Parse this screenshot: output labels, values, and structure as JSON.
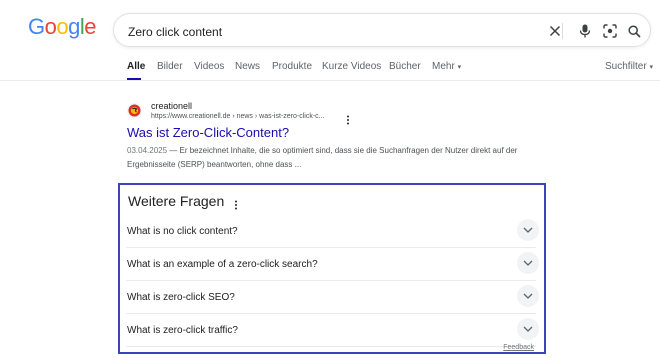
{
  "logo": {
    "letters": [
      "G",
      "o",
      "o",
      "g",
      "l",
      "e"
    ],
    "colors": [
      "#4285f4",
      "#ea4335",
      "#fbbc05",
      "#4285f4",
      "#34a853",
      "#ea4335"
    ]
  },
  "search": {
    "query": "Zero click content"
  },
  "tabs": [
    {
      "label": "Alle",
      "active": true
    },
    {
      "label": "Bilder"
    },
    {
      "label": "Videos"
    },
    {
      "label": "News"
    },
    {
      "label": "Produkte"
    },
    {
      "label": "Kurze Videos"
    },
    {
      "label": "Bücher"
    },
    {
      "label": "Mehr"
    }
  ],
  "tools_label": "Suchfilter",
  "result": {
    "site_name": "creationell",
    "url": "https://www.creationell.de › news › was-ist-zero-click-c...",
    "title": "Was ist Zero-Click-Content?",
    "date": "03.04.2025",
    "snippet": " — Er bezeichnet Inhalte, die so optimiert sind, dass sie die Suchanfragen der Nutzer direkt auf der Ergebnisseite (SERP) beantworten, ohne dass ..."
  },
  "paa": {
    "title": "Weitere Fragen",
    "questions": [
      "What is no click content?",
      "What is an example of a zero-click search?",
      "What is zero-click SEO?",
      "What is zero-click traffic?"
    ],
    "feedback": "Feedback"
  },
  "colors": {
    "link": "#1a0dab",
    "highlight_border": "#3b45b8"
  }
}
